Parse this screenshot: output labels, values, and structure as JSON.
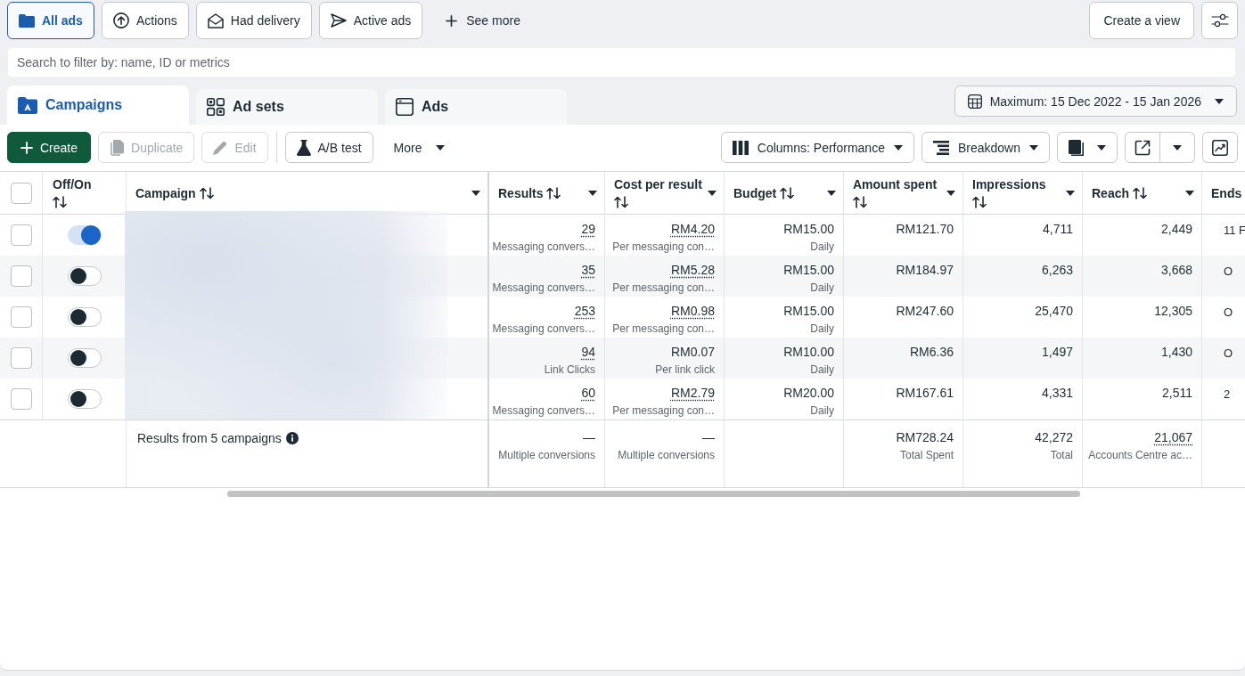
{
  "filters": [
    {
      "label": "All ads",
      "selected": true
    },
    {
      "label": "Actions",
      "selected": false
    },
    {
      "label": "Had delivery",
      "selected": false
    },
    {
      "label": "Active ads",
      "selected": false
    }
  ],
  "see_more": "See more",
  "create_view": "Create a view",
  "search": {
    "placeholder": "Search to filter by: name, ID or metrics"
  },
  "tabs": [
    {
      "label": "Campaigns",
      "selected": true
    },
    {
      "label": "Ad sets",
      "selected": false
    },
    {
      "label": "Ads",
      "selected": false
    }
  ],
  "date_range": "Maximum: 15 Dec 2022 - 15 Jan 2026",
  "toolbar": {
    "actions": [
      {
        "label": "Create",
        "kind": "primary",
        "disabled": false
      },
      {
        "label": "Duplicate",
        "kind": "secondary",
        "disabled": true
      },
      {
        "label": "Edit",
        "kind": "secondary",
        "disabled": true
      },
      {
        "label": "A/B test",
        "kind": "secondary",
        "disabled": false
      }
    ],
    "more": "More",
    "columns": "Columns: Performance",
    "breakdown": "Breakdown"
  },
  "table": {
    "select_all": {
      "checked": false
    },
    "columns": [
      {
        "label": "Off/On",
        "sortable": true,
        "menu": false
      },
      {
        "label": "Campaign",
        "sortable": true,
        "menu": true
      },
      {
        "label": "Results",
        "sortable": true,
        "menu": true
      },
      {
        "label": "Cost per result",
        "sortable": true,
        "menu": true
      },
      {
        "label": "Budget",
        "sortable": true,
        "menu": true
      },
      {
        "label": "Amount spent",
        "sortable": true,
        "menu": true
      },
      {
        "label": "Impressions",
        "sortable": true,
        "menu": true
      },
      {
        "label": "Reach",
        "sortable": true,
        "menu": true
      },
      {
        "label": "Ends"
      }
    ],
    "rows": [
      {
        "checked": false,
        "on": true,
        "results": {
          "value": "29",
          "label": "Messaging convers…",
          "underlined": true
        },
        "cost_per_result": {
          "value": "RM4.20",
          "label": "Per messaging con…",
          "underlined": true
        },
        "budget": {
          "value": "RM15.00",
          "label": "Daily",
          "underlined": false
        },
        "amount_spent": {
          "value": "RM121.70",
          "underlined": false
        },
        "impressions": {
          "value": "4,711",
          "underlined": false
        },
        "reach": {
          "value": "2,449",
          "underlined": false
        },
        "ends": "11 F"
      },
      {
        "checked": false,
        "on": false,
        "results": {
          "value": "35",
          "label": "Messaging convers…",
          "underlined": true
        },
        "cost_per_result": {
          "value": "RM5.28",
          "label": "Per messaging con…",
          "underlined": true
        },
        "budget": {
          "value": "RM15.00",
          "label": "Daily",
          "underlined": false
        },
        "amount_spent": {
          "value": "RM184.97",
          "underlined": false
        },
        "impressions": {
          "value": "6,263",
          "underlined": false
        },
        "reach": {
          "value": "3,668",
          "underlined": false
        },
        "ends": "O"
      },
      {
        "checked": false,
        "on": false,
        "results": {
          "value": "253",
          "label": "Messaging convers…",
          "underlined": true
        },
        "cost_per_result": {
          "value": "RM0.98",
          "label": "Per messaging con…",
          "underlined": true
        },
        "budget": {
          "value": "RM15.00",
          "label": "Daily",
          "underlined": false
        },
        "amount_spent": {
          "value": "RM247.60",
          "underlined": false
        },
        "impressions": {
          "value": "25,470",
          "underlined": false
        },
        "reach": {
          "value": "12,305",
          "underlined": false
        },
        "ends": "O"
      },
      {
        "checked": false,
        "on": false,
        "results": {
          "value": "94",
          "label": "Link Clicks",
          "underlined": true
        },
        "cost_per_result": {
          "value": "RM0.07",
          "label": "Per link click",
          "underlined": false
        },
        "budget": {
          "value": "RM10.00",
          "label": "Daily",
          "underlined": false
        },
        "amount_spent": {
          "value": "RM6.36",
          "underlined": false
        },
        "impressions": {
          "value": "1,497",
          "underlined": false
        },
        "reach": {
          "value": "1,430",
          "underlined": false
        },
        "ends": "O"
      },
      {
        "checked": false,
        "on": false,
        "results": {
          "value": "60",
          "label": "Messaging convers…",
          "underlined": true
        },
        "cost_per_result": {
          "value": "RM2.79",
          "label": "Per messaging con…",
          "underlined": true
        },
        "budget": {
          "value": "RM20.00",
          "label": "Daily",
          "underlined": false
        },
        "amount_spent": {
          "value": "RM167.61",
          "underlined": false
        },
        "impressions": {
          "value": "4,331",
          "underlined": false
        },
        "reach": {
          "value": "2,511",
          "underlined": false
        },
        "ends": "2"
      }
    ],
    "totals": {
      "label": "Results from 5 campaigns",
      "results": {
        "value": "—",
        "label": "Multiple conversions",
        "underlined": false
      },
      "cost_per_result": {
        "value": "—",
        "label": "Multiple conversions",
        "underlined": false
      },
      "amount_spent": {
        "value": "RM728.24",
        "label": "Total Spent",
        "underlined": false
      },
      "impressions": {
        "value": "42,272",
        "label": "Total",
        "underlined": false
      },
      "reach": {
        "value": "21,067",
        "label": "Accounts Centre ac…",
        "underlined": true
      }
    }
  }
}
